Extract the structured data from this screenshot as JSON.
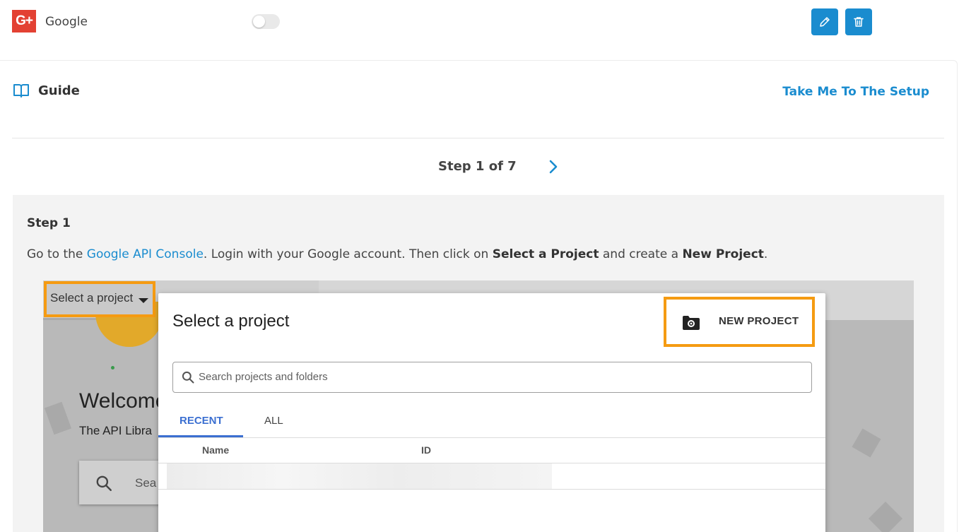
{
  "provider": {
    "logo_text": "G+",
    "name": "Google",
    "enabled": false
  },
  "actions": {
    "edit_icon": "pencil-icon",
    "delete_icon": "trash-icon"
  },
  "guide": {
    "title": "Guide",
    "setup_link": "Take Me To The Setup"
  },
  "stepper": {
    "label": "Step 1 of 7",
    "current": 1,
    "total": 7
  },
  "step": {
    "heading": "Step 1",
    "text_before": "Go to the ",
    "console_link": "Google API Console",
    "text_middle": ". Login with your Google account. Then click on ",
    "select_project": "Select a Project",
    "text_and": " and create a ",
    "new_project": "New Project",
    "text_end": "."
  },
  "screenshot": {
    "select_project_button": "Select a project",
    "welcome": "Welcome",
    "api_library": "The API Libra",
    "bg_search": "Sea",
    "dialog": {
      "title": "Select a project",
      "new_project_button": "NEW PROJECT",
      "search_placeholder": "Search projects and folders",
      "tabs": [
        "RECENT",
        "ALL"
      ],
      "columns": [
        "Name",
        "ID"
      ]
    }
  },
  "colors": {
    "accent": "#1a8ccf",
    "google_red": "#e34133",
    "highlight": "#f59b12",
    "tab_active": "#3b6fd1"
  }
}
